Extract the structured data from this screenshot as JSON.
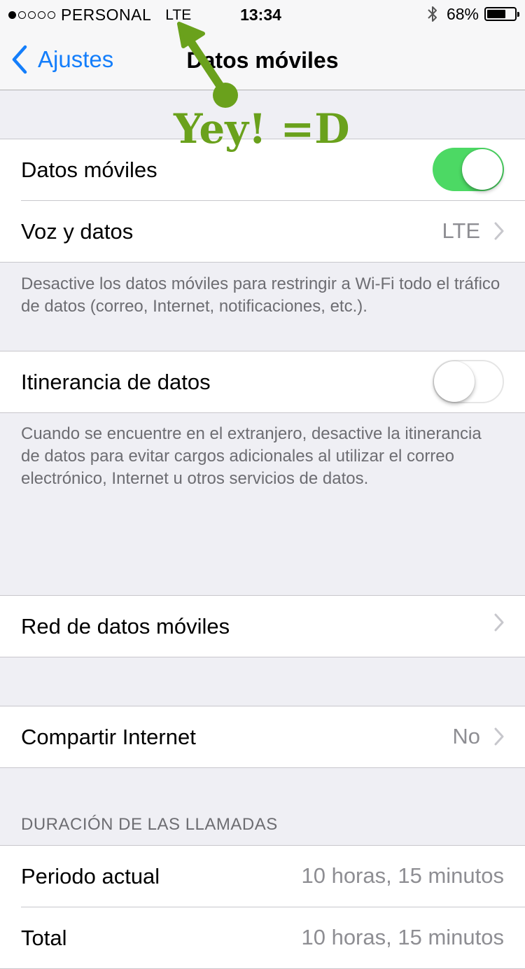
{
  "status_bar": {
    "signal_dots": [
      true,
      false,
      false,
      false,
      false
    ],
    "carrier": "PERSONAL",
    "network": "LTE",
    "time": "13:34",
    "bluetooth_icon": "bluetooth-icon",
    "battery_percent": "68%",
    "battery_level": 0.68
  },
  "nav": {
    "back_label": "Ajustes",
    "title": "Datos móviles"
  },
  "annotation": {
    "text": "Yey! =D",
    "color": "#6aa11c"
  },
  "groups": {
    "mobile_data": {
      "rows": [
        {
          "label": "Datos móviles",
          "toggle": true
        },
        {
          "label": "Voz y datos",
          "value": "LTE"
        }
      ],
      "footer": "Desactive los datos móviles para restringir a Wi-Fi todo el tráfico de datos (correo, Internet, notificaciones, etc.)."
    },
    "roaming": {
      "rows": [
        {
          "label": "Itinerancia de datos",
          "toggle": false
        }
      ],
      "footer": "Cuando se encuentre en el extranjero, desactive la itinerancia de datos para evitar cargos adicionales al utilizar el correo electrónico, Internet u otros servicios de datos."
    },
    "network": {
      "rows": [
        {
          "label": "Red de datos móviles"
        }
      ]
    },
    "hotspot": {
      "rows": [
        {
          "label": "Compartir Internet",
          "value": "No"
        }
      ]
    },
    "call_duration": {
      "header": "DURACIÓN DE LAS LLAMADAS",
      "rows": [
        {
          "label": "Periodo actual",
          "value": "10 horas, 15 minutos"
        },
        {
          "label": "Total",
          "value": "10 horas, 15 minutos"
        }
      ]
    }
  },
  "colors": {
    "accent": "#147efb",
    "toggle_on": "#4cd964",
    "background": "#efeff4"
  }
}
